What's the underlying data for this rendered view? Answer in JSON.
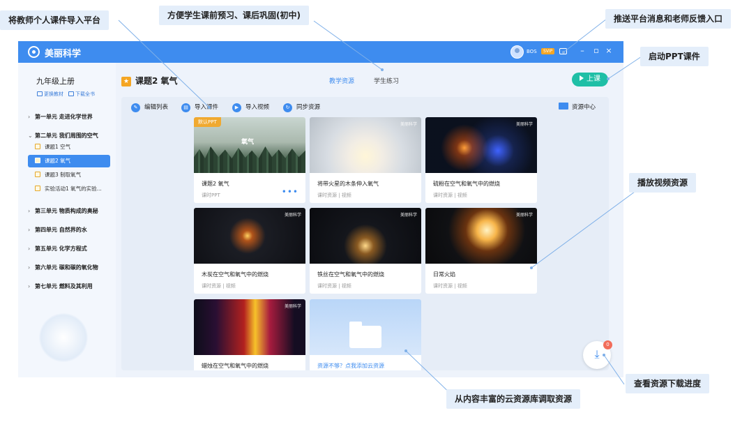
{
  "annotations": {
    "import_courseware": "将教师个人课件导入平台",
    "preview_review": "方便学生课前预习、课后巩固(初中)",
    "push_feedback": "推送平台消息和老师反馈入口",
    "start_ppt": "启动PPT课件",
    "play_video": "播放视频资源",
    "download_progress": "查看资源下载进度",
    "cloud_library": "从内容丰富的云资源库调取资源"
  },
  "app": {
    "title": "美丽科学",
    "username": "BOS",
    "vip_label": "SVIP",
    "window_controls": [
      "–",
      "▫",
      "×"
    ]
  },
  "sidebar": {
    "grade": "九年级上册",
    "change_book": "更换教材",
    "download_all": "下载全书",
    "units": [
      {
        "label": "第一单元 走进化学世界",
        "expanded": false
      },
      {
        "label": "第二单元 我们周围的空气",
        "expanded": true
      },
      {
        "label": "第三单元 物质构成的奥秘",
        "expanded": false
      },
      {
        "label": "第四单元 自然界的水",
        "expanded": false
      },
      {
        "label": "第五单元 化学方程式",
        "expanded": false
      },
      {
        "label": "第六单元 碳和碳的氧化物",
        "expanded": false
      },
      {
        "label": "第七单元 燃料及其利用",
        "expanded": false
      }
    ],
    "lessons": [
      {
        "label": "课题1 空气",
        "active": false
      },
      {
        "label": "课题2 氧气",
        "active": true
      },
      {
        "label": "课题3 制取氧气",
        "active": false
      },
      {
        "label": "实验活动1 氧气的实验...",
        "active": false
      }
    ]
  },
  "main": {
    "lesson_title": "课题2 氧气",
    "tabs": [
      {
        "label": "教学资源",
        "active": true
      },
      {
        "label": "学生练习",
        "active": false
      }
    ],
    "start_button": "上课",
    "toolbar": {
      "edit_list": "编辑列表",
      "import_courseware": "导入课件",
      "import_video": "导入视频",
      "sync_resources": "同步资源",
      "resource_center": "资源中心"
    },
    "brand_watermark": "美丽科学",
    "cards": [
      {
        "title": "课题2 氧气",
        "meta": "课时PPT",
        "tag": "默认PPT",
        "thumb_text": "氧气"
      },
      {
        "title": "将带火星的木条伸入氧气",
        "meta": "课时资源 | 视频"
      },
      {
        "title": "硫粉在空气和氧气中的燃烧",
        "meta": "课时资源 | 视频"
      },
      {
        "title": "木炭在空气和氧气中的燃烧",
        "meta": "课时资源 | 视频"
      },
      {
        "title": "铁丝在空气和氧气中的燃烧",
        "meta": "课时资源 | 视频"
      },
      {
        "title": "日常火焰",
        "meta": "课时资源 | 视频"
      },
      {
        "title": "蜡烛在空气和氧气中的燃烧",
        "meta": ""
      },
      {
        "title": "资源不够？点我添加云资源",
        "meta": ""
      }
    ]
  },
  "download": {
    "count": "0"
  },
  "colors": {
    "accent": "#3e8cef",
    "start_button": "#1fbfa6",
    "ppt_tag": "#f0a930",
    "callout_bg": "#e4eefa"
  }
}
